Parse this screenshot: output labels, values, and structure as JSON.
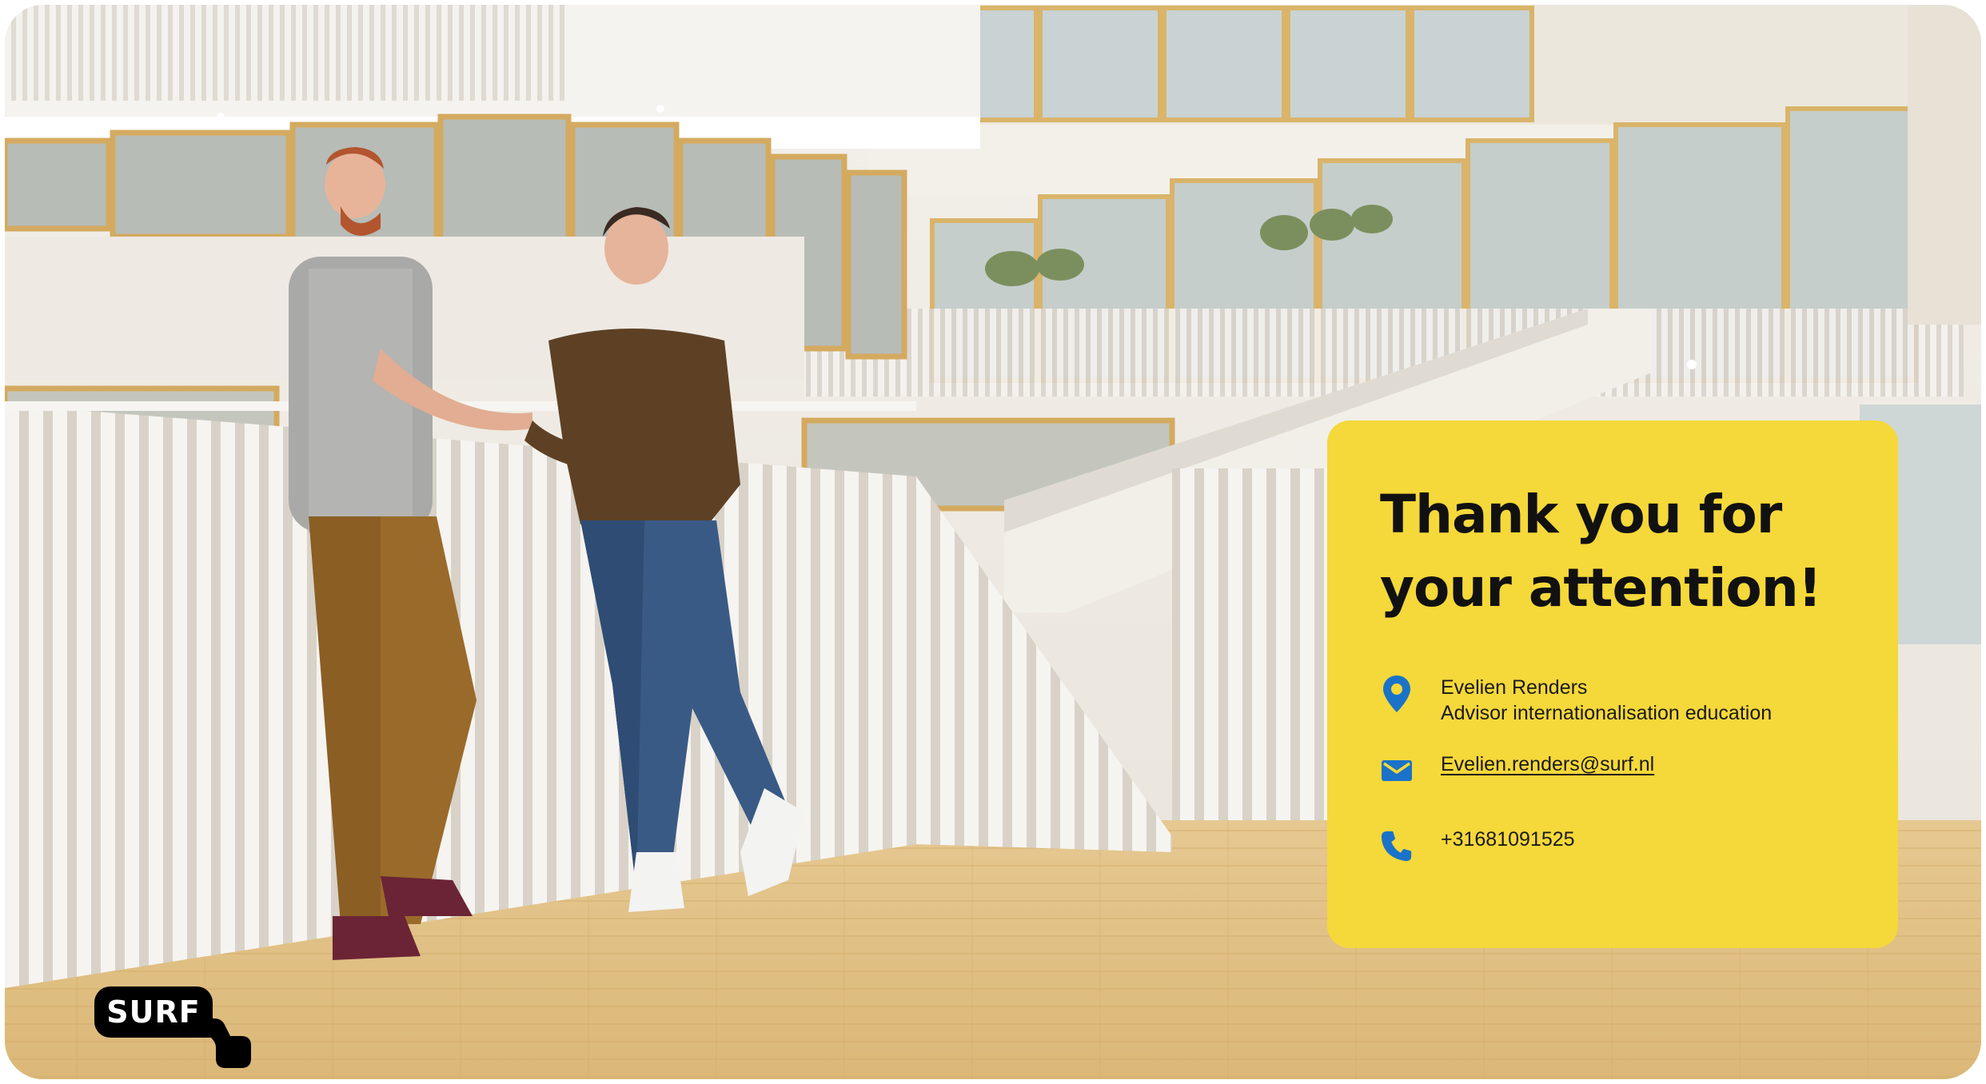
{
  "card": {
    "title": "Thank you for\nyour attention!",
    "name": "Evelien Renders",
    "role": "Advisor internationalisation education",
    "email": "Evelien.renders@surf.nl",
    "phone": "+31681091525"
  },
  "brand": {
    "logo_text": "SURF"
  },
  "colors": {
    "card_background": "#f5d83a",
    "icon_blue": "#1a73c8",
    "logo_black": "#000000"
  },
  "icons": {
    "location": "location-pin-icon",
    "email": "envelope-icon",
    "phone": "phone-icon"
  }
}
